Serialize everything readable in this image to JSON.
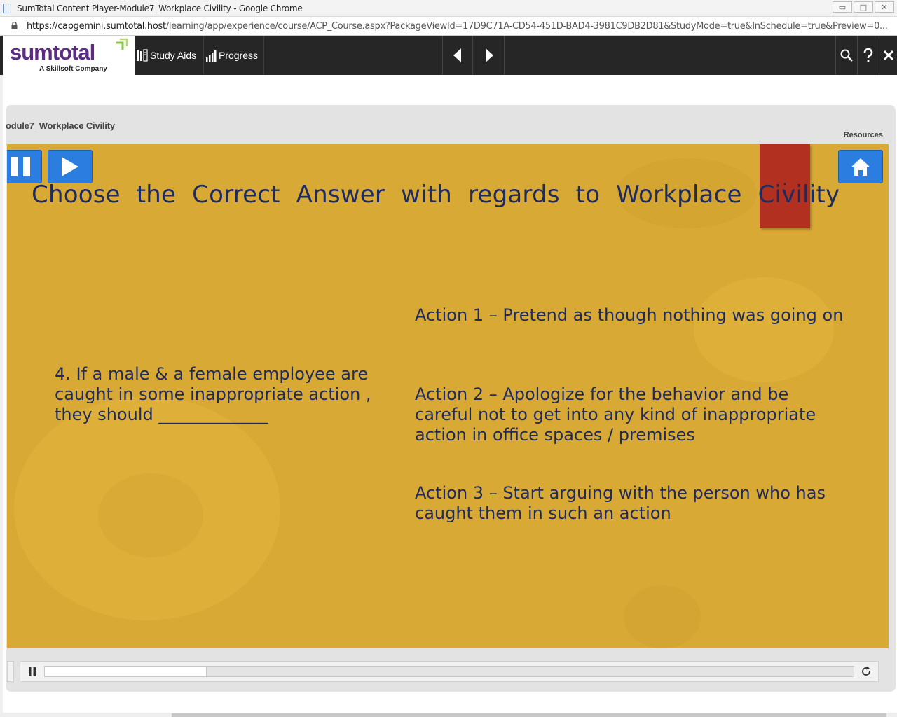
{
  "window": {
    "title": "SumTotal Content Player-Module7_Workplace Civility - Google Chrome",
    "buttons": [
      "▭",
      "□",
      "✕"
    ]
  },
  "address": {
    "url_host": "https://capgemini.sumtotal.host",
    "url_path": "/learning/app/experience/course/ACP_Course.aspx?PackageViewId=17D9C71A-CD54-451D-BAD4-3981C9DB2D81&StudyMode=true&InSchedule=true&Preview=0..."
  },
  "toolbar": {
    "logo_text": "sumtotal",
    "logo_sub": "A Skillsoft Company",
    "study_aids_label": "Study Aids",
    "progress_label": "Progress"
  },
  "player": {
    "module_title": "odule7_Workplace Civility",
    "resources_label": "Resources",
    "progress_fraction": 0.2
  },
  "slide": {
    "heading": "Choose  the Correct Answer  with regards to  Workplace Civility",
    "red_tab_text": ":",
    "question": "4. If a male & a female employee are caught in some inappropriate action , they should _____________",
    "actions": [
      "Action 1 – Pretend as though nothing was going on",
      "Action 2 – Apologize for the behavior and be careful not to get into any kind of  inappropriate action in office spaces / premises",
      "Action 3 –  Start arguing with the person who has caught them in such an action"
    ]
  },
  "colors": {
    "slide_bg": "#d8a935",
    "text": "#1e2b5e",
    "red_tab": "#b1301f",
    "button_blue": "#2b7de0",
    "toolbar": "#262626",
    "logo_purple": "#5b2c82"
  }
}
